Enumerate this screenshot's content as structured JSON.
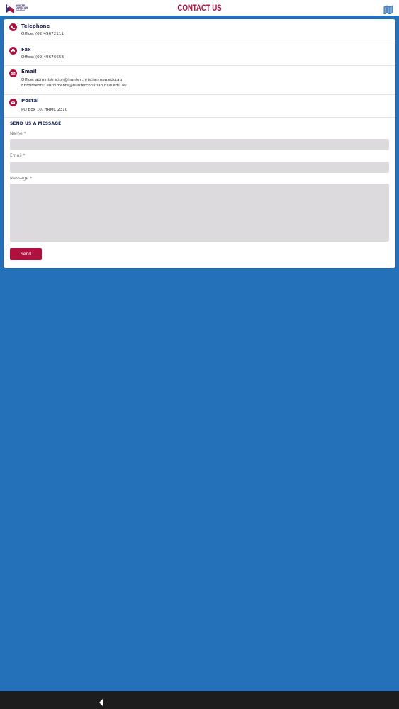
{
  "header": {
    "logo_text": "HUNTER\nCHRISTIAN\nSCHOOL",
    "title": "CONTACT US",
    "map_icon": "map-icon"
  },
  "contacts": [
    {
      "icon": "phone-icon",
      "label": "Telephone",
      "lines": [
        "Office: (02)49672111"
      ]
    },
    {
      "icon": "fax-icon",
      "label": "Fax",
      "lines": [
        "Office: (02)49676658"
      ]
    },
    {
      "icon": "email-icon",
      "label": "Email",
      "lines": [
        "Office: administration@hunterchristian.nsw.edu.au",
        "Enrolments: enrolments@hunterchristian.nsw.edu.au"
      ]
    },
    {
      "icon": "postal-icon",
      "label": "Postal",
      "lines": [
        "PO Box 10, HRMC 2310"
      ]
    }
  ],
  "form": {
    "section_title": "SEND US A MESSAGE",
    "name_label": "Name *",
    "name_value": "",
    "email_label": "Email *",
    "email_value": "",
    "message_label": "Message *",
    "message_value": "",
    "send_label": "Send"
  },
  "colors": {
    "accent": "#b0103e",
    "background": "#2470b9",
    "heading": "#1f2a55"
  },
  "navbar": {
    "back_icon": "back-triangle-icon"
  }
}
